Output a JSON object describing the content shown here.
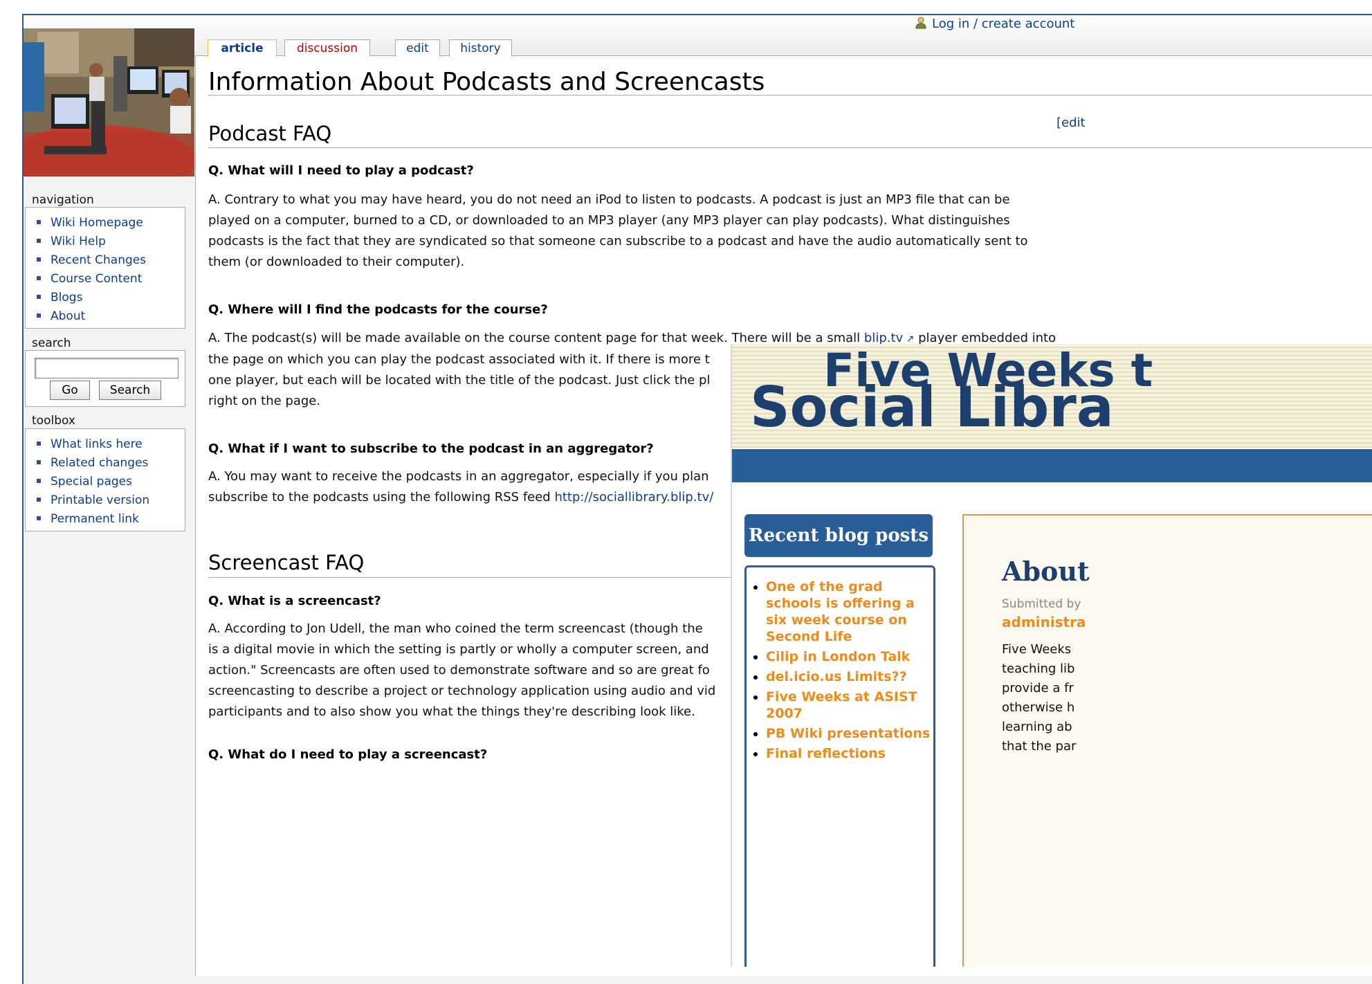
{
  "header": {
    "login_label": "Log in / create account"
  },
  "tabs": {
    "article": "article",
    "discussion": "discussion",
    "edit": "edit",
    "history": "history"
  },
  "sidebar": {
    "navigation_title": "navigation",
    "navigation_items": [
      "Wiki Homepage",
      "Wiki Help",
      "Recent Changes",
      "Course Content",
      "Blogs",
      "About"
    ],
    "search_title": "search",
    "search_value": "",
    "go_label": "Go",
    "search_label": "Search",
    "toolbox_title": "toolbox",
    "toolbox_items": [
      "What links here",
      "Related changes",
      "Special pages",
      "Printable version",
      "Permanent link"
    ]
  },
  "article": {
    "title": "Information About Podcasts and Screencasts",
    "edit_link": "[edit",
    "podcast_heading": "Podcast FAQ",
    "q1": "Q. What will I need to play a podcast?",
    "a1_lines": [
      "A. Contrary to what you may have heard, you do not need an iPod to listen to podcasts. A podcast is just an MP3 file that can be",
      "played on a computer, burned to a CD, or downloaded to an MP3 player (any MP3 player can play podcasts). What distinguishes",
      "podcasts is the fact that they are syndicated so that someone can subscribe to a podcast and have the audio automatically sent to",
      "them (or downloaded to their computer)."
    ],
    "q2": "Q. Where will I find the podcasts for the course?",
    "a2_line1_pre": "A. The podcast(s) will be made available on the course content page for that week. There will be a small ",
    "a2_line1_link": "blip.tv",
    "a2_line1_post": " player embedded into",
    "a2_lines": [
      "the page on which you can play the podcast associated with it. If there is more t",
      "one player, but each will be located with the title of the podcast. Just click the pl",
      "right on the page."
    ],
    "q3": "Q. What if I want to subscribe to the podcast in an aggregator?",
    "a3_line1": "A. You may want to receive the podcasts in an aggregator, especially if you plan",
    "a3_line2_pre": "subscribe to the podcasts using the following RSS feed ",
    "a3_line2_link": "http://sociallibrary.blip.tv/",
    "screencast_heading": "Screencast FAQ",
    "q4": "Q. What is a screencast?",
    "a4_lines": [
      "A. According to Jon Udell, the man who coined the term screencast (though the",
      "is a digital movie in which the setting is partly or wholly a computer screen, and",
      "action.\" Screencasts are often used to demonstrate software and so are great fo",
      "screencasting to describe a project or technology application using audio and vid",
      "participants and to also show you what the things they're describing look like."
    ],
    "q5": "Q. What do I need to play a screencast?"
  },
  "overlay": {
    "title_line1": "Five Weeks t",
    "title_line2": "Social Libra",
    "recent_heading": "Recent blog posts",
    "recent_posts": [
      "One of the grad schools is offering a six week course on Second Life",
      "Cilip in London Talk",
      "del.icio.us Limits??",
      "Five Weeks at ASIST 2007",
      "PB Wiki presentations",
      "Final reflections"
    ],
    "about_heading": "About",
    "submitted": "Submitted by",
    "admin": "administra",
    "body_lines": [
      "Five Weeks",
      "teaching lib",
      "provide a fr",
      "otherwise h",
      "learning ab",
      "that the par"
    ]
  }
}
